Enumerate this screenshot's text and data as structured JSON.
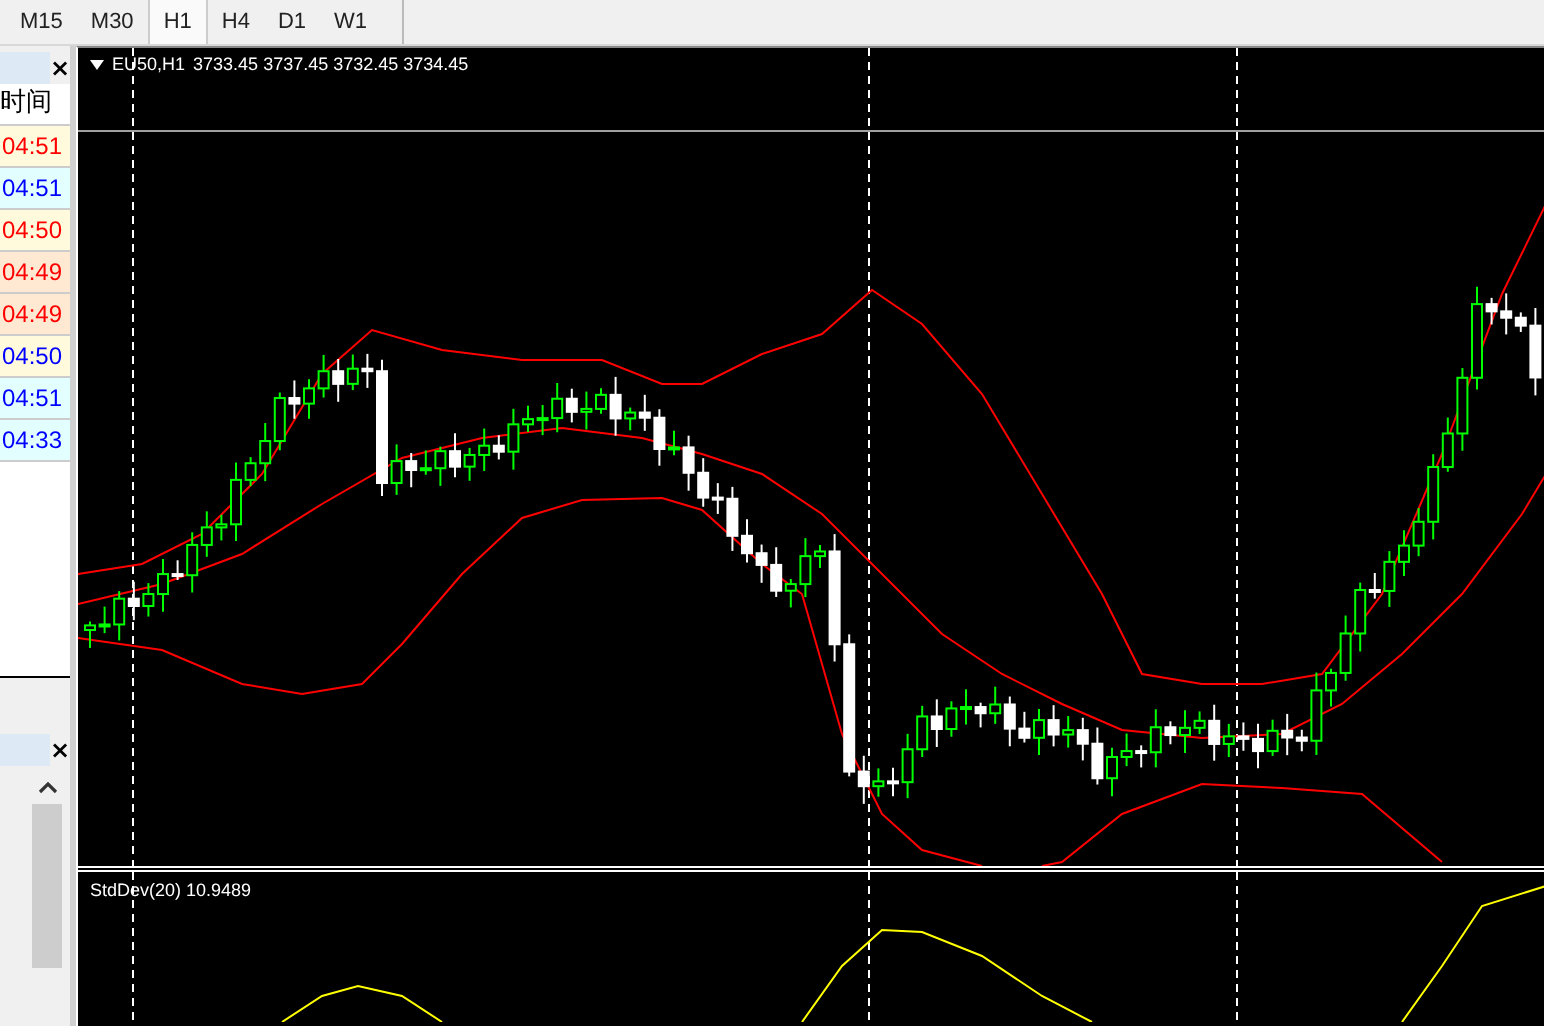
{
  "toolbar": {
    "timeframes": [
      {
        "label": "M15",
        "selected": false
      },
      {
        "label": "M30",
        "selected": false
      },
      {
        "label": "H1",
        "selected": true
      },
      {
        "label": "H4",
        "selected": false
      },
      {
        "label": "D1",
        "selected": false
      },
      {
        "label": "W1",
        "selected": false
      }
    ]
  },
  "side_panel": {
    "close": "×",
    "column": "时间",
    "rows": [
      {
        "time": "04:51",
        "color": "#ff0000",
        "kind": "cream"
      },
      {
        "time": "04:51",
        "color": "#0000ff",
        "kind": "cyan"
      },
      {
        "time": "04:50",
        "color": "#ff0000",
        "kind": "cream"
      },
      {
        "time": "04:49",
        "color": "#ff0000",
        "kind": "peach"
      },
      {
        "time": "04:49",
        "color": "#ff0000",
        "kind": "peach"
      },
      {
        "time": "04:50",
        "color": "#0000ff",
        "kind": "cream"
      },
      {
        "time": "04:51",
        "color": "#0000ff",
        "kind": "cyan"
      },
      {
        "time": "04:33",
        "color": "#0000ff",
        "kind": "cyan"
      }
    ]
  },
  "bottom_panel": {
    "close": "×"
  },
  "chart": {
    "symbol": "EU50,H1",
    "ohlc": "3733.45 3737.45 3732.45 3734.45",
    "indicator": "StdDev(20) 10.9489"
  }
}
